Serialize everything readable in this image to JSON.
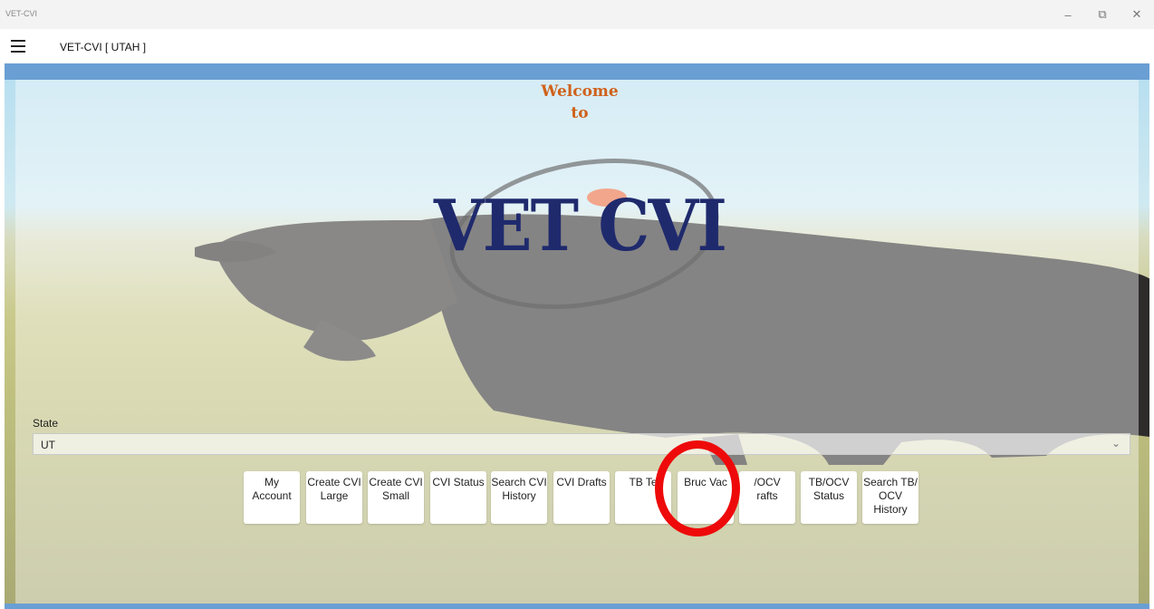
{
  "window": {
    "title": "VET-CVI"
  },
  "header": {
    "title": "VET-CVI [ UTAH ]"
  },
  "welcome": {
    "line1": "Welcome",
    "line2": "to"
  },
  "logo": {
    "text": "VET CVI"
  },
  "state": {
    "label": "State",
    "value": "UT"
  },
  "nav_buttons": [
    "My\nAccount",
    "Create CVI\nLarge",
    "Create CVI\nSmall",
    "CVI Status",
    "Search CVI\nHistory",
    "CVI Drafts",
    "TB Te",
    "Bruc Vac",
    "/OCV\nrafts",
    "TB/OCV\nStatus",
    "Search TB/\nOCV\nHistory"
  ],
  "icons": {
    "menu": "hamburger-icon",
    "minimize": "minimize-icon",
    "restore": "restore-icon",
    "close": "close-icon",
    "dropdown": "chevron-down-icon"
  },
  "colors": {
    "accent_bar": "#6a9fd4",
    "welcome_text": "#d0611a",
    "logo_text": "#1f2a6d",
    "highlight_circle": "#ee0a0a"
  }
}
